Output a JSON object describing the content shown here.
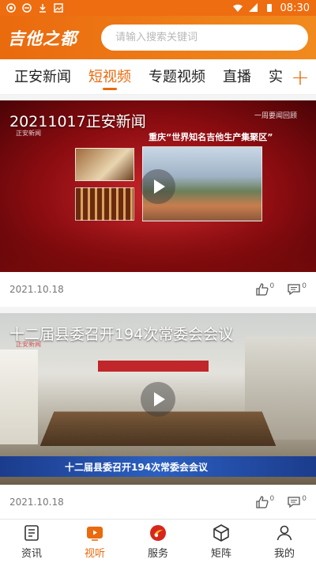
{
  "status_bar": {
    "time": "08:30"
  },
  "header": {
    "logo": "吉他之都",
    "search_placeholder": "请输入搜索关键词"
  },
  "tabs": [
    {
      "label": "正安新闻",
      "active": false
    },
    {
      "label": "短视频",
      "active": true
    },
    {
      "label": "专题视频",
      "active": false
    },
    {
      "label": "直播",
      "active": false
    },
    {
      "label": "实",
      "active": false
    }
  ],
  "tabs_more_icon": "plus-icon",
  "feed": [
    {
      "title": "20211017正安新闻",
      "date": "2021.10.18",
      "likes": "0",
      "comments": "0",
      "overlay_banner": "重庆“世界知名吉他生产集聚区”",
      "overlay_corner": "一周要闻回顾",
      "overlay_logo": "正安新闻"
    },
    {
      "title": "十二届县委召开194次常委会会议",
      "date": "2021.10.18",
      "likes": "0",
      "comments": "0",
      "overlay_banner": "十二届县委召开194次常委会会议",
      "overlay_logo": "正安新闻"
    }
  ],
  "bottom_nav": [
    {
      "label": "资讯",
      "icon": "news-icon",
      "active": false
    },
    {
      "label": "视听",
      "icon": "video-icon",
      "active": true
    },
    {
      "label": "服务",
      "icon": "service-icon",
      "active": false
    },
    {
      "label": "矩阵",
      "icon": "cube-icon",
      "active": false
    },
    {
      "label": "我的",
      "icon": "user-icon",
      "active": false
    }
  ],
  "colors": {
    "accent": "#ea6a0e",
    "status_bar": "#ee6d10"
  }
}
